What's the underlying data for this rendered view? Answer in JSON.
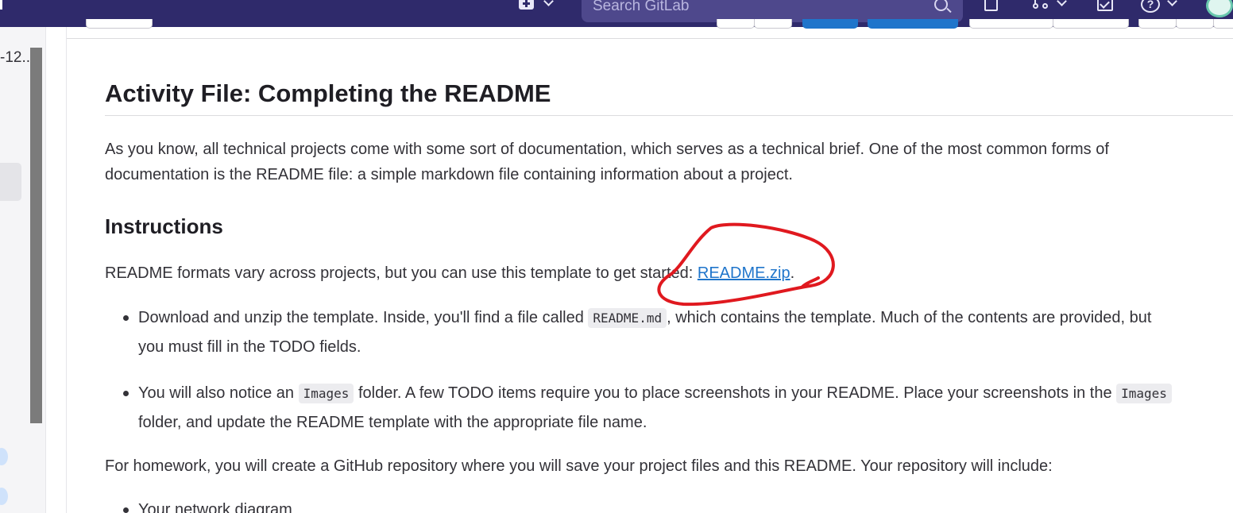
{
  "topbar": {
    "search_placeholder": "Search GitLab",
    "icons": [
      "plus-square-icon",
      "chevron-down-icon",
      "search-icon",
      "doc-edit-icon",
      "merge-request-icon",
      "todo-check-icon",
      "help-icon",
      "avatar"
    ],
    "bg_color": "#2f2a6b"
  },
  "sidebar": {
    "truncated_label": "-12.."
  },
  "article": {
    "title": "Activity File: Completing the README",
    "intro_line1": "As you know, all technical projects come with some sort of documentation, which serves as a technical brief. One of the most common forms of",
    "intro_line2": "documentation is the README file: a simple markdown file containing information about a project.",
    "instructions_heading": "Instructions",
    "template_text": "README formats vary across projects, but you can use this template to get started: ",
    "template_link": "README.zip",
    "template_end": ".",
    "bullet1_a": "Download and unzip the template. Inside, you'll find a file called ",
    "bullet1_code": "README.md",
    "bullet1_b": ", which contains the template. Much of the contents are provided, but",
    "bullet1_line2": "you must fill in the TODO fields.",
    "bullet2_a": "You will also notice an ",
    "bullet2_code1": "Images",
    "bullet2_b": " folder. A few TODO items require you to place screenshots in your README. Place your screenshots in the ",
    "bullet2_code2": "Images",
    "bullet2_line2": "folder, and update the README template with the appropriate file name.",
    "homework_text": "For homework, you will create a GitHub repository where you will save your project files and this README. Your repository will include:",
    "bullet3": "Your network diagram"
  },
  "annotation": {
    "color": "#e0191f"
  }
}
